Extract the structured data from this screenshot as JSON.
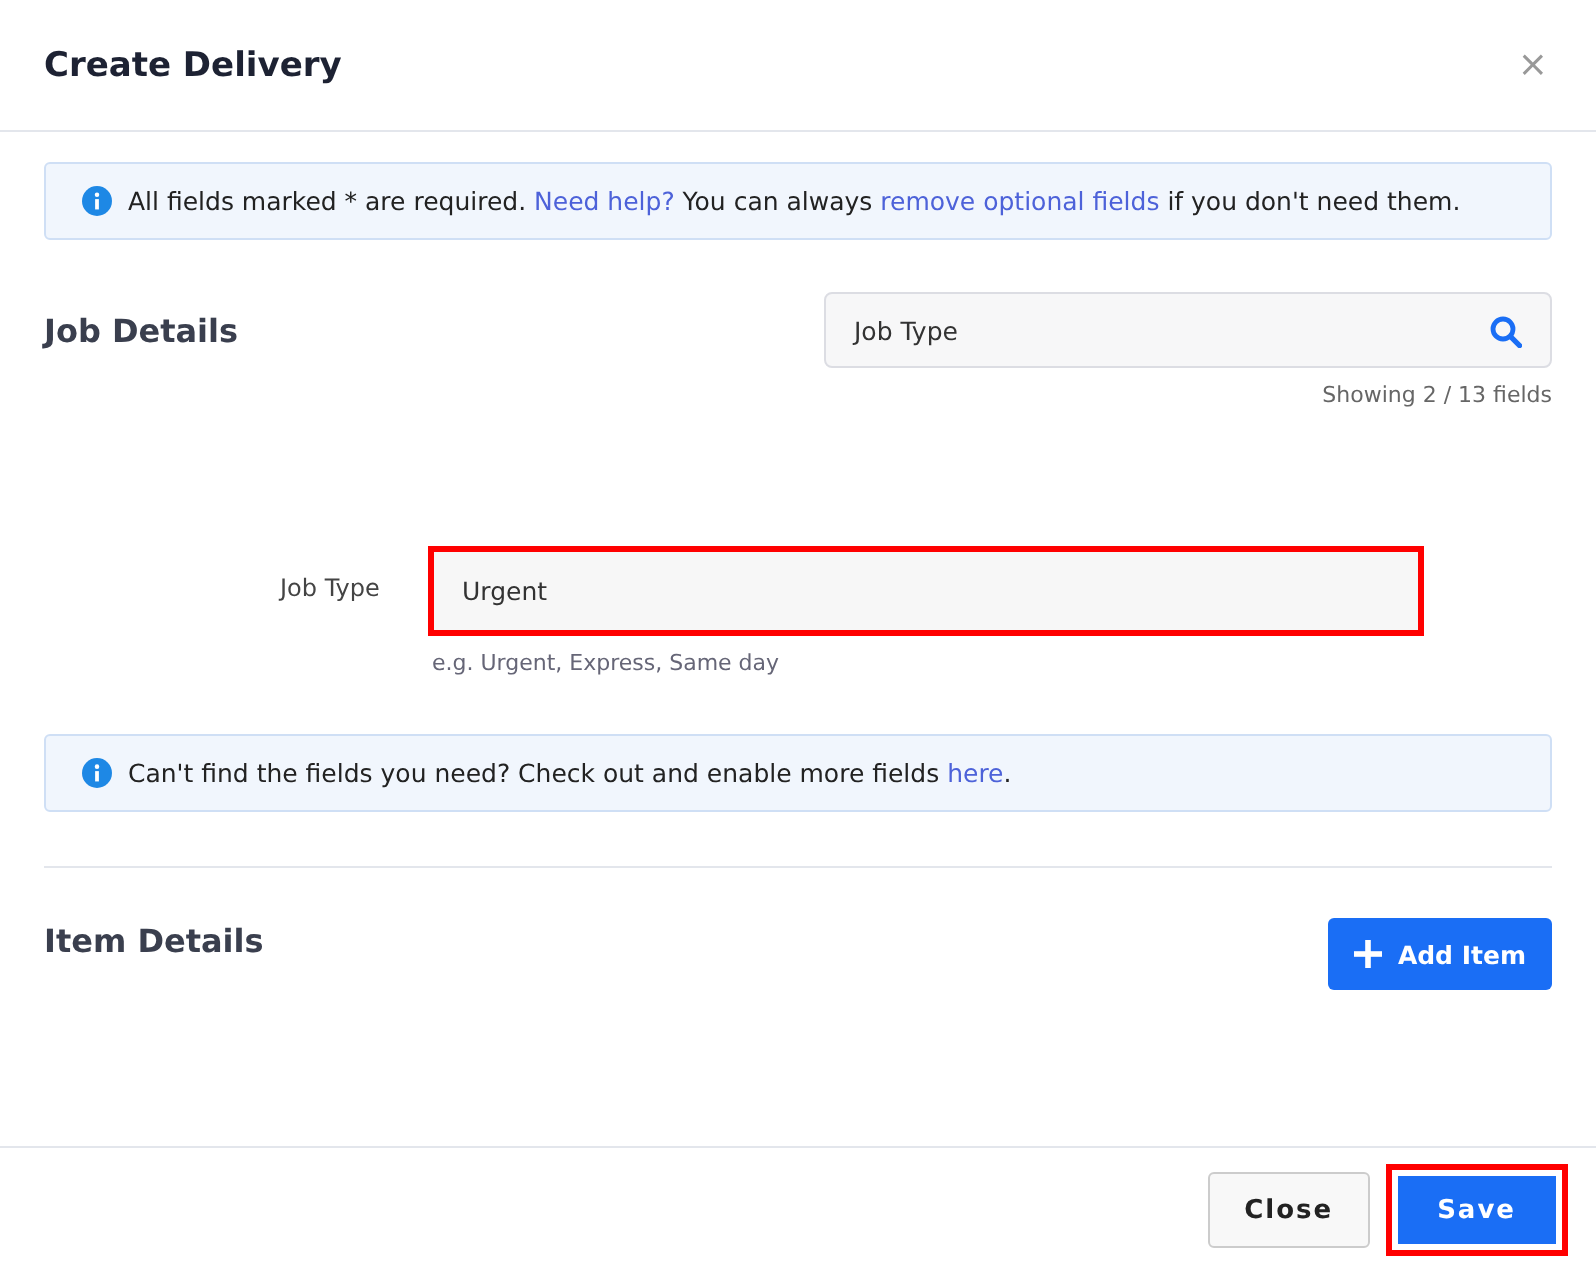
{
  "dialog": {
    "title": "Create Delivery",
    "close_label": "×"
  },
  "notice_top": [
    {
      "kind": "text",
      "text": "All fields marked * are required. "
    },
    {
      "kind": "link",
      "text": "Need help?"
    },
    {
      "kind": "text",
      "text": " You can always "
    },
    {
      "kind": "link",
      "text": "remove optional fields"
    },
    {
      "kind": "text",
      "text": " if you don't need them."
    }
  ],
  "job_details": {
    "heading": "Job Details",
    "search": {
      "value": "Job Type"
    },
    "count": "Showing 2 / 13 fields",
    "fields": [
      {
        "label": "Job Type",
        "value": "Urgent",
        "hint": "e.g. Urgent, Express, Same day",
        "highlighted": true
      }
    ]
  },
  "notice_bottom": [
    {
      "kind": "text",
      "text": "Can't find the fields you need? Check out and enable more fields "
    },
    {
      "kind": "link",
      "text": "here"
    },
    {
      "kind": "text",
      "text": "."
    }
  ],
  "item_details": {
    "heading": "Item Details",
    "add_button": "Add Item"
  },
  "footer": {
    "buttons": [
      {
        "label": "Close",
        "kind": "secondary",
        "highlighted": false
      },
      {
        "label": "Save",
        "kind": "primary",
        "highlighted": true
      }
    ]
  }
}
